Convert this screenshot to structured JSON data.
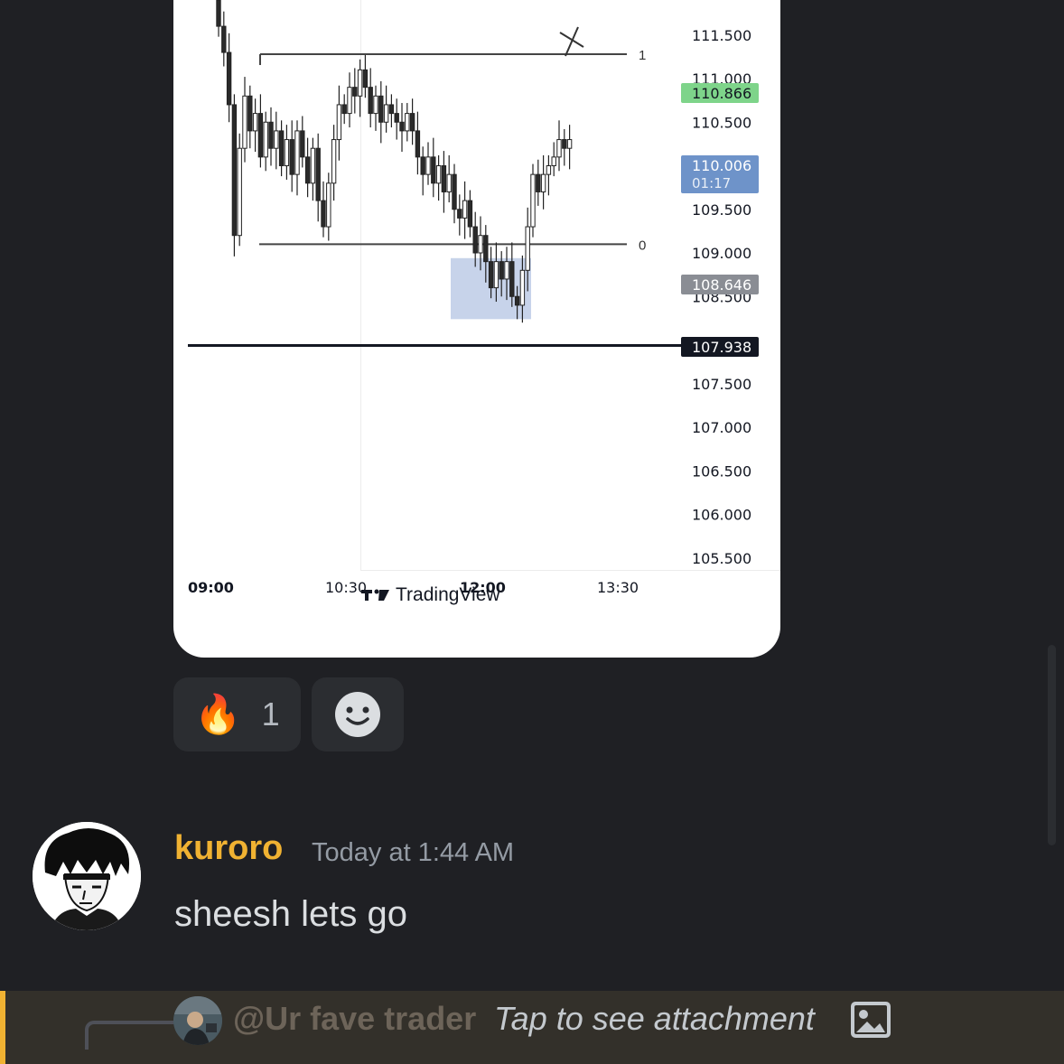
{
  "chart_data": {
    "type": "candlestick",
    "ylim": [
      105.25,
      112.0
    ],
    "y_ticks": [
      "111.500",
      "111.000",
      "110.500",
      "109.500",
      "109.000",
      "108.500",
      "107.500",
      "107.000",
      "106.500",
      "106.000",
      "105.500"
    ],
    "x_ticks": [
      {
        "label": "09:00",
        "bold": true
      },
      {
        "label": "10:30",
        "bold": false
      },
      {
        "label": "12:00",
        "bold": true
      },
      {
        "label": "13:30",
        "bold": false
      }
    ],
    "price_labels": [
      {
        "value": "110.866",
        "bg": "#7ed48a"
      },
      {
        "value": "110.006",
        "sub": "01:17",
        "bg": "#6e93c9"
      },
      {
        "value": "108.646",
        "bg": "#8a8d94"
      },
      {
        "value": "107.938",
        "bg": "#131722"
      }
    ],
    "fib_levels": [
      {
        "label": "1",
        "price": 111.28
      },
      {
        "label": "0",
        "price": 109.1
      }
    ],
    "horizontal_line": 107.938,
    "highlight_zone": {
      "price_high": 108.94,
      "price_low": 108.24
    },
    "candle_closes": [
      111.6,
      111.3,
      110.7,
      109.2,
      110.2,
      110.8,
      110.4,
      110.6,
      110.1,
      110.5,
      110.2,
      110.4,
      110.0,
      110.3,
      109.9,
      110.4,
      110.1,
      109.8,
      110.2,
      109.6,
      109.3,
      109.8,
      110.3,
      110.7,
      110.6,
      110.9,
      110.8,
      111.1,
      110.9,
      110.6,
      110.8,
      110.5,
      110.7,
      110.6,
      110.5,
      110.4,
      110.6,
      110.4,
      110.1,
      109.9,
      110.1,
      109.8,
      110.0,
      109.7,
      109.9,
      109.5,
      109.4,
      109.6,
      109.3,
      109.0,
      109.2,
      108.9,
      108.6,
      108.9,
      108.7,
      108.9,
      108.5,
      108.4,
      108.8,
      109.3,
      109.9,
      109.7,
      109.9,
      110.0,
      110.1,
      110.3,
      110.2,
      110.3
    ]
  },
  "tradingview": {
    "label": "TradingView"
  },
  "reactions": [
    {
      "emoji": "🔥",
      "count": "1"
    },
    {
      "emoji_name": "add-reaction-smiley"
    }
  ],
  "message": {
    "username": "kuroro",
    "timestamp": "Today at 1:44 AM",
    "text": "sheesh lets go",
    "username_color": "#f0b232"
  },
  "reply": {
    "mention": "@Ur fave trader",
    "text": "Tap to see attachment",
    "icon": "image-icon"
  }
}
